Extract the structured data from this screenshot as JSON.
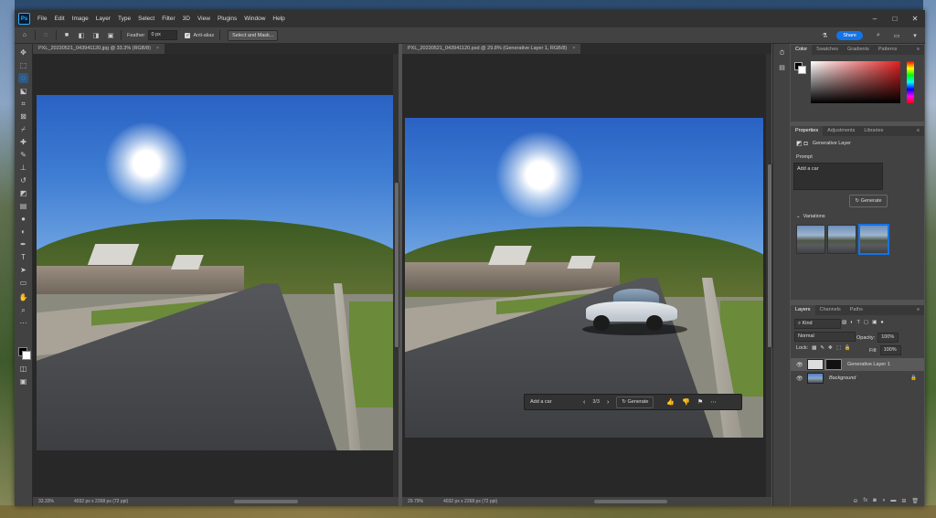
{
  "menus": [
    "File",
    "Edit",
    "Image",
    "Layer",
    "Type",
    "Select",
    "Filter",
    "3D",
    "View",
    "Plugins",
    "Window",
    "Help"
  ],
  "app_logo": "Ps",
  "options": {
    "feather_label": "Feather:",
    "feather_value": "0 px",
    "antialias_label": "Anti-alias",
    "select_mask": "Select and Mask...",
    "share": "Share"
  },
  "doc_left": {
    "tab": "PXL_20230521_043941120.jpg @ 33.3% (RGB/8)",
    "zoom": "33.33%",
    "size": "4032 px x 2268 px (72 ppi)"
  },
  "doc_right": {
    "tab": "PXL_20230521_043941120.psd @ 29.8% (Generative Layer 1, RGB/8)",
    "zoom": "29.79%",
    "size": "4032 px x 2268 px (72 ppi)"
  },
  "genbar": {
    "prompt": "Add a car",
    "count": "3/3",
    "generate": "Generate"
  },
  "color_panel": {
    "tabs": [
      "Color",
      "Swatches",
      "Gradients",
      "Patterns"
    ],
    "accent": "#e02020"
  },
  "props_panel": {
    "tabs": [
      "Properties",
      "Adjustments",
      "Libraries"
    ],
    "layer_type": "Generative Layer",
    "prompt_label": "Prompt",
    "prompt_text": "Add a car",
    "generate": "Generate",
    "variations_label": "Variations"
  },
  "layers_panel": {
    "tabs": [
      "Layers",
      "Channels",
      "Paths"
    ],
    "kind": "Kind",
    "blend": "Normal",
    "opacity_label": "Opacity:",
    "opacity": "100%",
    "lock_label": "Lock:",
    "fill_label": "Fill:",
    "fill": "100%",
    "layers": [
      {
        "name": "Generative Layer 1"
      },
      {
        "name": "Background"
      }
    ]
  }
}
